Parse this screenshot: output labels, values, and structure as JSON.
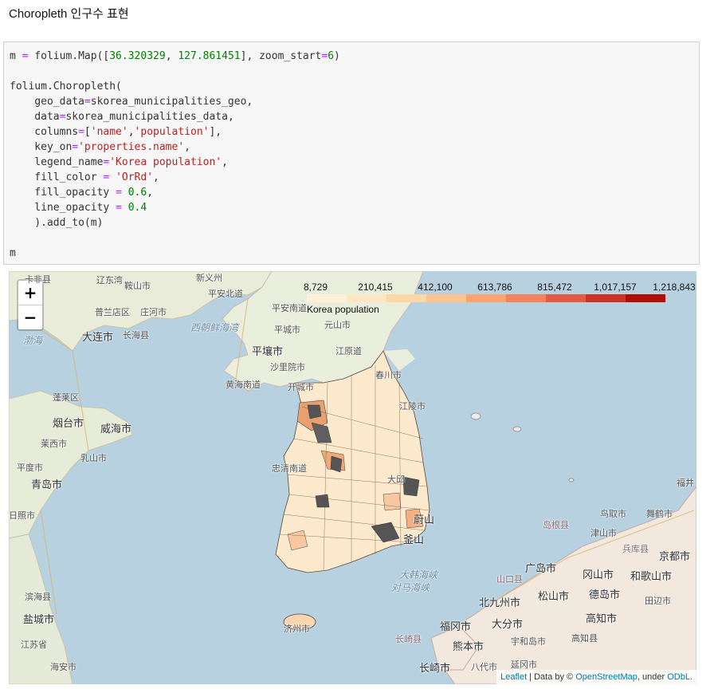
{
  "heading": "Choropleth 인구수 표현",
  "code": {
    "lines": [
      [
        [
          "m ",
          "kw"
        ],
        [
          "=",
          "op"
        ],
        [
          " folium.Map([",
          "kw"
        ],
        [
          "36.320329",
          "num"
        ],
        [
          ", ",
          "kw"
        ],
        [
          "127.861451",
          "num"
        ],
        [
          "], zoom_start",
          "kw"
        ],
        [
          "=",
          "op"
        ],
        [
          "6",
          "num"
        ],
        [
          ")",
          "kw"
        ]
      ],
      [],
      [
        [
          "folium.Choropleth(",
          "kw"
        ]
      ],
      [
        [
          "    geo_data",
          "kw"
        ],
        [
          "=",
          "op"
        ],
        [
          "skorea_municipalities_geo,",
          "kw"
        ]
      ],
      [
        [
          "    data",
          "kw"
        ],
        [
          "=",
          "op"
        ],
        [
          "skorea_municipalities_data,",
          "kw"
        ]
      ],
      [
        [
          "    columns",
          "kw"
        ],
        [
          "=",
          "op"
        ],
        [
          "[",
          "kw"
        ],
        [
          "'name'",
          "str"
        ],
        [
          ",",
          "kw"
        ],
        [
          "'population'",
          "str"
        ],
        [
          "],",
          "kw"
        ]
      ],
      [
        [
          "    key_on",
          "kw"
        ],
        [
          "=",
          "op"
        ],
        [
          "'properties.name'",
          "str"
        ],
        [
          ",",
          "kw"
        ]
      ],
      [
        [
          "    legend_name",
          "kw"
        ],
        [
          "=",
          "op"
        ],
        [
          "'Korea population'",
          "str"
        ],
        [
          ",",
          "kw"
        ]
      ],
      [
        [
          "    fill_color ",
          "kw"
        ],
        [
          "=",
          "op"
        ],
        [
          " ",
          "kw"
        ],
        [
          "'OrRd'",
          "str"
        ],
        [
          ",",
          "kw"
        ]
      ],
      [
        [
          "    fill_opacity ",
          "kw"
        ],
        [
          "=",
          "op"
        ],
        [
          " ",
          "kw"
        ],
        [
          "0.6",
          "num"
        ],
        [
          ",",
          "kw"
        ]
      ],
      [
        [
          "    line_opacity ",
          "kw"
        ],
        [
          "=",
          "op"
        ],
        [
          " ",
          "kw"
        ],
        [
          "0.4",
          "num"
        ]
      ],
      [
        [
          "    ).add_to(m)",
          "kw"
        ]
      ],
      [],
      [
        [
          "m",
          "kw"
        ]
      ]
    ]
  },
  "zoom": {
    "in_label": "+",
    "out_label": "−"
  },
  "legend": {
    "ticks": [
      "8,729",
      "210,415",
      "412,100",
      "613,786",
      "815,472",
      "1,017,157",
      "1,218,843"
    ],
    "colors": [
      "#fef0d9",
      "#fde7c3",
      "#fdd8a7",
      "#fdc38d",
      "#fca36f",
      "#f4825a",
      "#e45a42",
      "#cc3322",
      "#b00d05"
    ],
    "name": "Korea population"
  },
  "attribution": {
    "leaflet": "Leaflet",
    "sep1": " | Data by © ",
    "osm": "OpenStreetMap",
    "sep2": ", under ",
    "odbl": "ODbL."
  },
  "map_labels": [
    {
      "text": "卡非县"
    },
    {
      "text": "辽东湾"
    },
    {
      "text": "鞍山市"
    },
    {
      "text": "新义州"
    },
    {
      "text": "普兰店区"
    },
    {
      "text": "庄河市"
    },
    {
      "text": "平安北道"
    },
    {
      "text": "大连市"
    },
    {
      "text": "长海县"
    },
    {
      "text": "渤海"
    },
    {
      "text": "西朝鲜海湾"
    },
    {
      "text": "平壤市"
    },
    {
      "text": "平安南道"
    },
    {
      "text": "平城市"
    },
    {
      "text": "元山市"
    },
    {
      "text": "江原道"
    },
    {
      "text": "沙里院市"
    },
    {
      "text": "黄海南道"
    },
    {
      "text": "开城市"
    },
    {
      "text": "春川市"
    },
    {
      "text": "江陵市"
    },
    {
      "text": "蓬莱区"
    },
    {
      "text": "烟台市"
    },
    {
      "text": "威海市"
    },
    {
      "text": "莱西市"
    },
    {
      "text": "乳山市"
    },
    {
      "text": "平度市"
    },
    {
      "text": "青岛市"
    },
    {
      "text": "日照市"
    },
    {
      "text": "滨海县"
    },
    {
      "text": "盐城市"
    },
    {
      "text": "江苏省"
    },
    {
      "text": "南通市"
    },
    {
      "text": "海安市"
    },
    {
      "text": "忠清南道"
    },
    {
      "text": "大邱"
    },
    {
      "text": "蔚山"
    },
    {
      "text": "釜山"
    },
    {
      "text": "济州市"
    },
    {
      "text": "大韩海峡"
    },
    {
      "text": "鸟取市"
    },
    {
      "text": "舞鹤市"
    },
    {
      "text": "福井"
    },
    {
      "text": "岛根县"
    },
    {
      "text": "津山市"
    },
    {
      "text": "兵库县"
    },
    {
      "text": "京都市"
    },
    {
      "text": "广岛市"
    },
    {
      "text": "冈山市"
    },
    {
      "text": "和歌山市"
    },
    {
      "text": "山口县"
    },
    {
      "text": "北九州市"
    },
    {
      "text": "松山市"
    },
    {
      "text": "德岛市"
    },
    {
      "text": "田辺市"
    },
    {
      "text": "福冈市"
    },
    {
      "text": "大分市"
    },
    {
      "text": "高知市"
    },
    {
      "text": "长崎县"
    },
    {
      "text": "熊本市"
    },
    {
      "text": "宇和岛市"
    },
    {
      "text": "高知县"
    },
    {
      "text": "长崎市"
    },
    {
      "text": "八代市"
    },
    {
      "text": "延冈市"
    },
    {
      "text": "对马海峡"
    }
  ]
}
